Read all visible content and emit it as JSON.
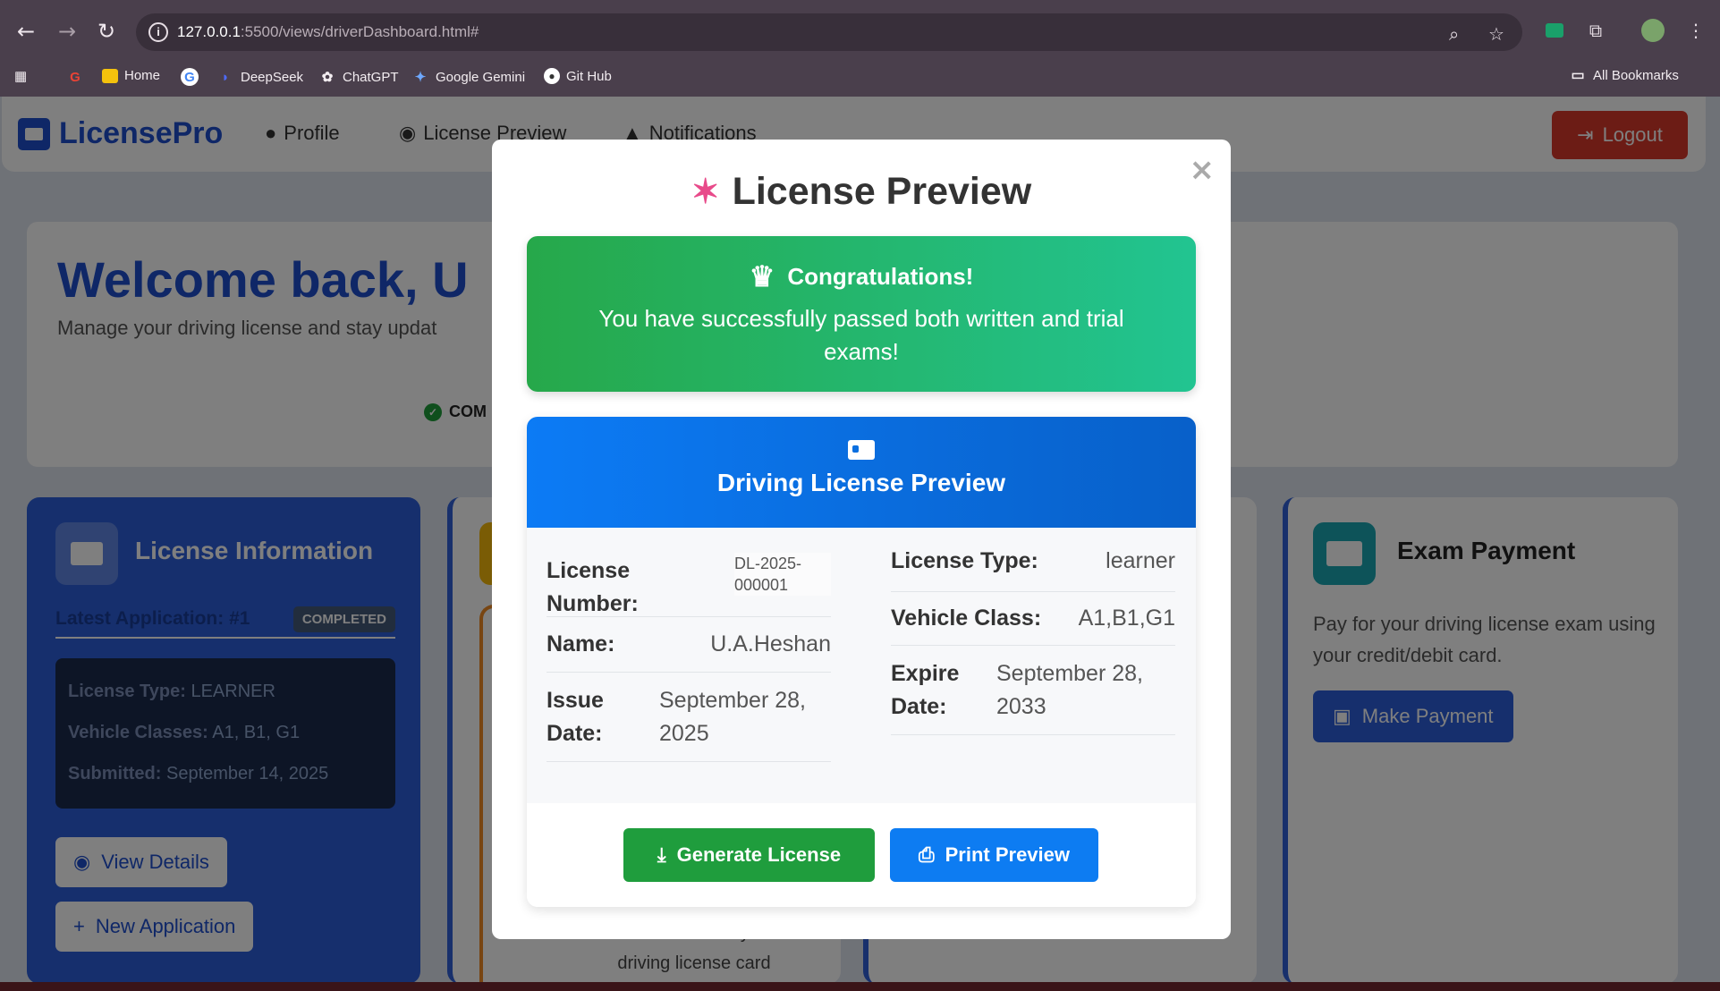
{
  "browser": {
    "url_host": "127.0.0.1",
    "url_path": ":5500/views/driverDashboard.html#",
    "bookmarks": [
      "Home",
      "DeepSeek",
      "ChatGPT",
      "Google Gemini",
      "Git Hub"
    ],
    "all_bookmarks": "All Bookmarks"
  },
  "app": {
    "brand": "LicensePro",
    "nav": {
      "profile": "Profile",
      "license_preview": "License Preview",
      "notifications": "Notifications"
    },
    "logout": "Logout",
    "welcome_title": "Welcome back, U",
    "welcome_sub": "Manage your driving license and stay updat",
    "status_text": "COM",
    "license_card": {
      "title": "License Information",
      "latest": "Latest Application: #1",
      "badge": "COMPLETED",
      "type_label": "License Type:",
      "type_value": "LEARNER",
      "classes_label": "Vehicle Classes:",
      "classes_value": "A1, B1, G1",
      "submitted_label": "Submitted:",
      "submitted_value": "September 14, 2025",
      "view_details": "View Details",
      "new_application": "New Application"
    },
    "middle_text": "You will receive your driving license card",
    "exam": {
      "title": "Exam Payment",
      "desc": "Pay for your driving license exam using your credit/debit card.",
      "button": "Make Payment"
    }
  },
  "modal": {
    "title": "License Preview",
    "congrats_title": "Congratulations!",
    "congrats_msg": "You have successfully passed both written and trial exams!",
    "card_title": "Driving License Preview",
    "fields": {
      "number_label": "License Number:",
      "number_value": "DL-2025-000001",
      "name_label": "Name:",
      "name_value": "U.A.Heshan",
      "issue_label": "Issue Date:",
      "issue_value": "September 28, 2025",
      "type_label": "License Type:",
      "type_value": "learner",
      "class_label": "Vehicle Class:",
      "class_value": "A1,B1,G1",
      "expire_label": "Expire Date:",
      "expire_value": "September 28, 2033"
    },
    "generate": "Generate License",
    "print": "Print Preview"
  }
}
